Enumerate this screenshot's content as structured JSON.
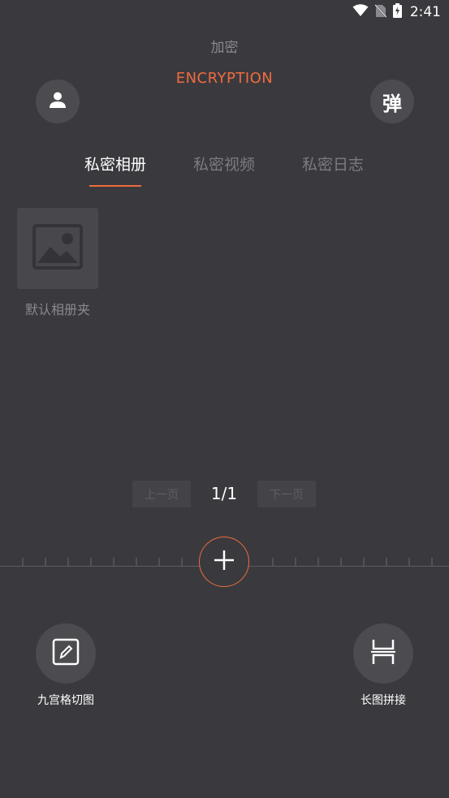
{
  "status_bar": {
    "time": "2:41"
  },
  "header": {
    "subtitle": "加密",
    "title": "ENCRYPTION",
    "popup_label": "弹"
  },
  "tabs": [
    {
      "label": "私密相册",
      "active": true
    },
    {
      "label": "私密视频",
      "active": false
    },
    {
      "label": "私密日志",
      "active": false
    }
  ],
  "albums": [
    {
      "name": "默认相册夹"
    }
  ],
  "pager": {
    "prev_label": "上一页",
    "indicator": "1/1",
    "next_label": "下一页"
  },
  "tools": [
    {
      "label": "九宫格切图",
      "icon": "edit-icon"
    },
    {
      "label": "长图拼接",
      "icon": "stitch-icon"
    }
  ],
  "colors": {
    "accent": "#f06b3e",
    "background": "#3a3a3e",
    "button": "#4c4c50"
  }
}
